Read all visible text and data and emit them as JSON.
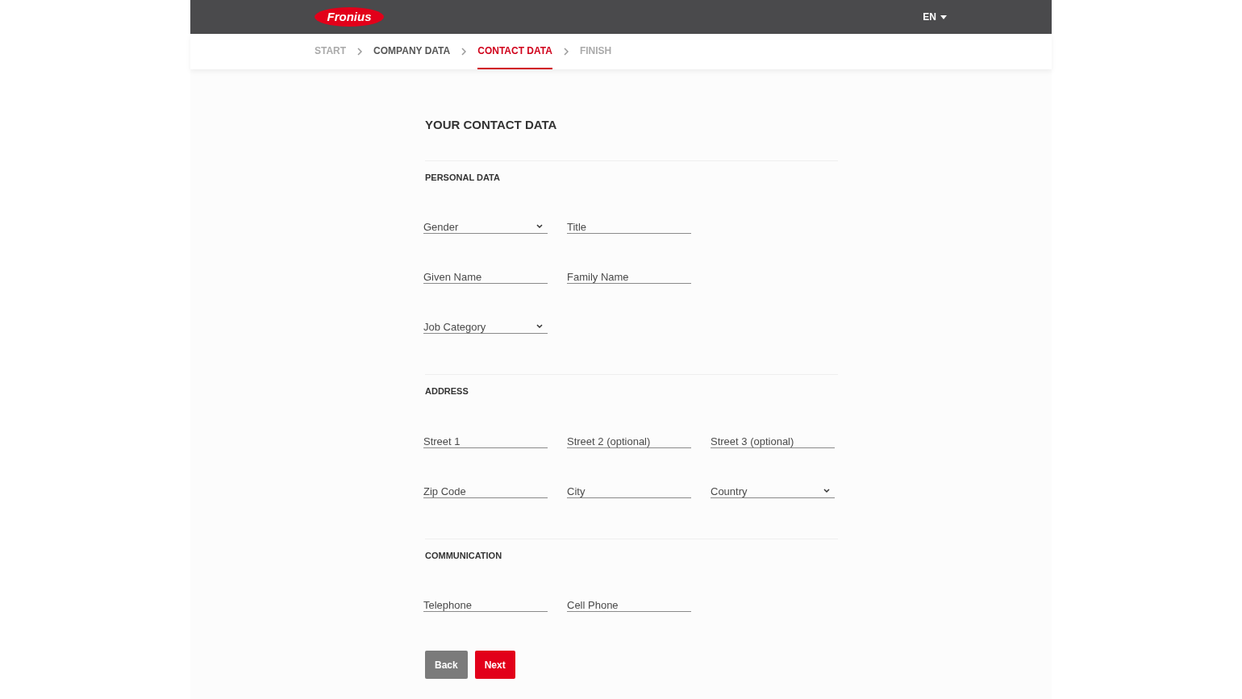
{
  "header": {
    "logo": "Fronius",
    "language": "EN"
  },
  "steps": [
    {
      "label": "START",
      "selected": false,
      "completed": false
    },
    {
      "label": "COMPANY DATA",
      "selected": false,
      "completed": true
    },
    {
      "label": "CONTACT DATA",
      "selected": true,
      "completed": false
    },
    {
      "label": "FINISH",
      "selected": false,
      "completed": false
    }
  ],
  "title": "YOUR CONTACT DATA",
  "sections": [
    {
      "heading": "PERSONAL DATA",
      "rows": [
        [
          {
            "kind": "select",
            "placeholder": "Gender"
          },
          {
            "kind": "text",
            "placeholder": "Title"
          }
        ],
        [
          {
            "kind": "text",
            "placeholder": "Given Name"
          },
          {
            "kind": "text",
            "placeholder": "Family Name"
          }
        ],
        [
          {
            "kind": "select",
            "placeholder": "Job Category"
          }
        ]
      ]
    },
    {
      "heading": "ADDRESS",
      "rows": [
        [
          {
            "kind": "text",
            "placeholder": "Street 1"
          },
          {
            "kind": "text",
            "placeholder": "Street 2 (optional)"
          },
          {
            "kind": "text",
            "placeholder": "Street 3 (optional)"
          }
        ],
        [
          {
            "kind": "text",
            "placeholder": "Zip Code"
          },
          {
            "kind": "text",
            "placeholder": "City"
          },
          {
            "kind": "select",
            "placeholder": "Country"
          }
        ]
      ]
    },
    {
      "heading": "COMMUNICATION",
      "rows": [
        [
          {
            "kind": "text",
            "placeholder": "Telephone"
          },
          {
            "kind": "text",
            "placeholder": "Cell Phone"
          }
        ]
      ]
    }
  ],
  "buttons": [
    {
      "label": "Back",
      "kind": "secondary"
    },
    {
      "label": "Next",
      "kind": "primary"
    }
  ]
}
